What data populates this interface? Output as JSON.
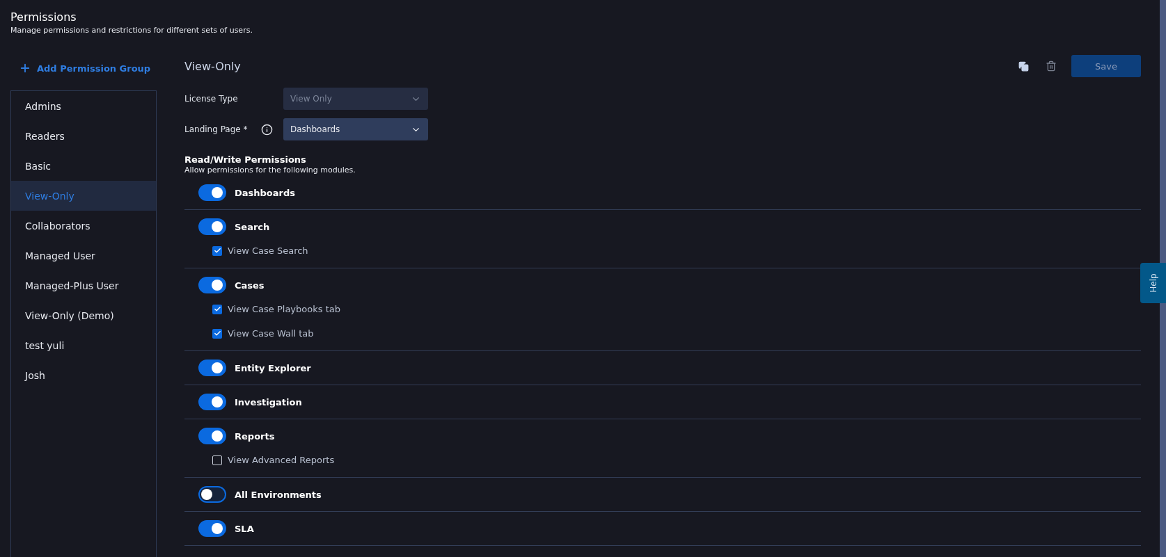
{
  "page": {
    "title": "Permissions",
    "subtitle": "Manage permissions and restrictions for different sets of users."
  },
  "add_button": {
    "label": "Add Permission Group"
  },
  "groups": [
    {
      "label": "Admins",
      "selected": false
    },
    {
      "label": "Readers",
      "selected": false
    },
    {
      "label": "Basic",
      "selected": false
    },
    {
      "label": "View-Only",
      "selected": true
    },
    {
      "label": "Collaborators",
      "selected": false
    },
    {
      "label": "Managed User",
      "selected": false
    },
    {
      "label": "Managed-Plus User",
      "selected": false
    },
    {
      "label": "View-Only (Demo)",
      "selected": false
    },
    {
      "label": "test yuli",
      "selected": false
    },
    {
      "label": "Josh",
      "selected": false
    }
  ],
  "detail": {
    "title": "View-Only",
    "save_label": "Save",
    "fields": [
      {
        "label": "License Type",
        "value": "View Only",
        "disabled": true,
        "info": false
      },
      {
        "label": "Landing Page *",
        "value": "Dashboards",
        "disabled": false,
        "info": true
      }
    ],
    "section_title": "Read/Write Permissions",
    "section_subtitle": "Allow permissions for the following modules.",
    "modules": [
      {
        "name": "Dashboards",
        "on": true
      },
      {
        "name": "Search",
        "on": true,
        "options": [
          {
            "label": "View Case Search",
            "checked": true
          }
        ]
      },
      {
        "name": "Cases",
        "on": true,
        "options": [
          {
            "label": "View Case Playbooks tab",
            "checked": true
          },
          {
            "label": "View Case Wall tab",
            "checked": true
          }
        ]
      },
      {
        "name": "Entity Explorer",
        "on": true
      },
      {
        "name": "Investigation",
        "on": true
      },
      {
        "name": "Reports",
        "on": true,
        "options": [
          {
            "label": "View Advanced Reports",
            "checked": false
          }
        ]
      },
      {
        "name": "All Environments",
        "on": false
      },
      {
        "name": "SLA",
        "on": true
      }
    ]
  },
  "help_tab": {
    "label": "Help"
  }
}
